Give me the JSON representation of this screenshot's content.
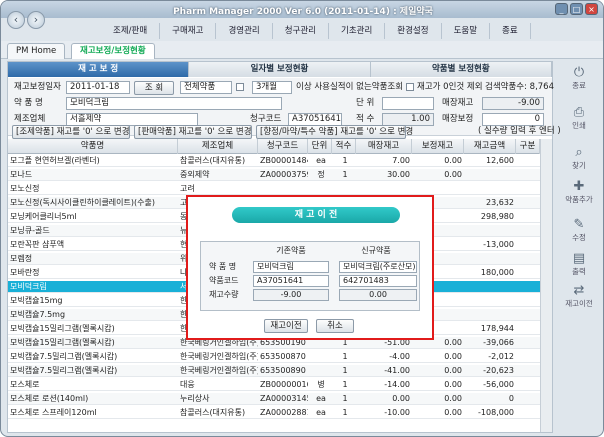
{
  "window": {
    "title": "Pharm Manager 2000 Ver 6.0  (2011-01-14) : 제일약국"
  },
  "menu": [
    "조제/판매",
    "구매재고",
    "경영관리",
    "청구관리",
    "기초관리",
    "환경설정",
    "도움말",
    "종료"
  ],
  "tabs": [
    "PM Home",
    "재고보정/보정현황"
  ],
  "subtabs": [
    "재 고 보 정",
    "일자별 보정현황",
    "약품별 보정현황"
  ],
  "form": {
    "date_label": "재고보정일자",
    "date_value": "2011-01-18",
    "search_button": "조 회",
    "filter_select": "전체약품",
    "months_select": "3개월",
    "unused_label": "이상 사용실적이 없는약품조회",
    "zero_label": "재고가 0인것 제외",
    "search_count": "검색약품수: 8,764",
    "drug_label": "약 품 명",
    "drug_value": "모비덕크림",
    "unit_label": "단 위",
    "sales_stock_label": "매장재고",
    "sales_stock_value": "-9.00",
    "maker_label": "제조업체",
    "maker_value": "서흘제약",
    "code_label": "청구코드",
    "code_value": "A37051641",
    "qty_label": "적 수",
    "qty_value": "1.00",
    "adjust_label": "매장보정",
    "adjust_value": "0",
    "hint": "( 실수량 입력 후 엔터 )",
    "btn_rx_zero": "[조제약품] 재고를 '0' 으로 변경",
    "btn_sale_zero": "[판매약품] 재고를 '0' 으로 변경",
    "btn_special_zero": "[향정/마약/특수 약품] 재고를 '0' 으로 변경"
  },
  "grid": {
    "headers": [
      "약품명",
      "제조업체",
      "청구코드",
      "단위",
      "적수",
      "매장재고",
      "보정재고",
      "재고금액",
      "구분"
    ],
    "rows": [
      [
        "모그플 현연허브겔(라벤더)",
        "참콜러스(대지유통)",
        "ZB00001484",
        "ea",
        "1",
        "7.00",
        "0.00",
        "12,600",
        ""
      ],
      [
        "모나드",
        "중외제약",
        "ZA00003759",
        "정",
        "1",
        "30.00",
        "0.00",
        "",
        ""
      ],
      [
        "모노신정",
        "고려",
        "",
        "",
        "",
        "",
        "",
        "",
        ""
      ],
      [
        "모노신정(독시사이클린하이클레이트)(수출)",
        "고려",
        "",
        "",
        "",
        "",
        "",
        "23,632",
        ""
      ],
      [
        "모닝케어클리너5ml",
        "동",
        "",
        "",
        "",
        "",
        "",
        "298,980",
        ""
      ],
      [
        "모닝큐-골드",
        "뉴",
        "",
        "",
        "",
        "",
        "",
        "",
        ""
      ],
      [
        "모란꼭판 샴푸액",
        "현",
        "",
        "",
        "",
        "",
        "",
        "-13,000",
        ""
      ],
      [
        "모렘정",
        "위",
        "",
        "",
        "",
        "",
        "",
        "",
        ""
      ],
      [
        "모바란정",
        "나",
        "",
        "",
        "",
        "",
        "",
        "180,000",
        ""
      ],
      [
        "모비덕크림",
        "서",
        "",
        "",
        "",
        "",
        "",
        "",
        ""
      ],
      [
        "모빅캡슐15mg",
        "한",
        "",
        "",
        "",
        "",
        "",
        "",
        ""
      ],
      [
        "모빅캡슐7.5mg",
        "한",
        "",
        "",
        "",
        "",
        "",
        "",
        ""
      ],
      [
        "모빅캡슐15밀리그램(멜록시캄)",
        "한",
        "",
        "",
        "",
        "",
        "",
        "178,944",
        ""
      ],
      [
        "모빅캡슐15밀리그램(멜록시캄)",
        "한국베링거인겔하임(주)",
        "653500190",
        "",
        "1",
        "-51.00",
        "0.00",
        "-39,066",
        ""
      ],
      [
        "모빅캡슐7.5밀리그램(멜록시캄)",
        "한국베링거인겔하임(주)",
        "653500870",
        "",
        "1",
        "-4.00",
        "0.00",
        "-2,012",
        ""
      ],
      [
        "모빅캡슐7.5밀리그램(멜록시캄)",
        "한국베링거인겔하임(주)",
        "653500890",
        "",
        "1",
        "-41.00",
        "0.00",
        "-20,623",
        ""
      ],
      [
        "모스체로",
        "대웅",
        "ZB00000016",
        "병",
        "1",
        "-14.00",
        "0.00",
        "-56,000",
        ""
      ],
      [
        "모스체로 로션(140ml)",
        "누리상사",
        "ZA00003145",
        "ea",
        "1",
        "0.00",
        "0.00",
        "0",
        ""
      ],
      [
        "모스체로 스프레이120ml",
        "참콜러스(대지유통)",
        "ZA00002881",
        "ea",
        "1",
        "-10.00",
        "0.00",
        "-108,000",
        ""
      ]
    ]
  },
  "sidebar": [
    "종료",
    "인쇄",
    "찾기",
    "약품추가",
    "수정",
    "출력",
    "재고이전"
  ],
  "modal": {
    "title": "재 고 이 전",
    "col_before": "기존약품",
    "col_after": "신규약품",
    "lbl_name": "약 품 명",
    "lbl_code": "약품코드",
    "lbl_qty": "재고수량",
    "before_name": "모비덕크림",
    "before_code": "A37051641",
    "before_qty": "-9.00",
    "after_name": "모비덕크림(주로산모)",
    "after_code": "642701483",
    "after_qty": "0.00",
    "btn_ok": "재고이전",
    "btn_cancel": "취소"
  }
}
